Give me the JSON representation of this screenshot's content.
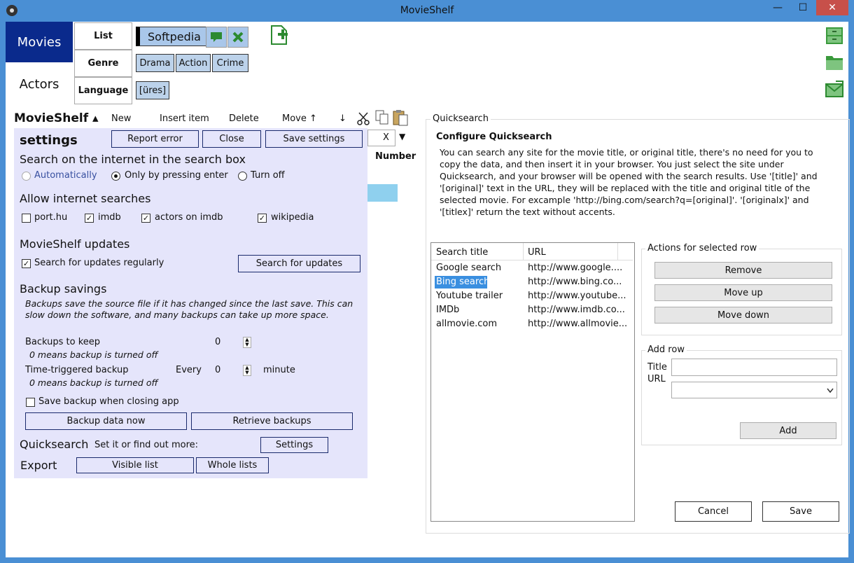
{
  "window": {
    "title": "MovieShelf",
    "minimize": "—",
    "maximize": "☐",
    "close": "✕"
  },
  "nav": {
    "movies": "Movies",
    "actors": "Actors"
  },
  "views": {
    "list": "List",
    "genre": "Genre",
    "language": "Language"
  },
  "filters": {
    "tag": "Softpedia",
    "genres": [
      "Drama",
      "Action",
      "Crime"
    ],
    "language_value": "[üres]"
  },
  "toolbar": {
    "brand": "MovieShelf ▴",
    "new": "New",
    "insert": "Insert item",
    "delete": "Delete",
    "move_up": "Move ↑",
    "move_down": "↓",
    "clear": "X",
    "dropdown": "▼",
    "column_number": "Number"
  },
  "settings": {
    "title": "settings",
    "report_error": "Report error",
    "close": "Close",
    "save_settings": "Save settings",
    "search_header": "Search on the internet in the search box",
    "search_options": [
      "Automatically",
      "Only by pressing enter",
      "Turn off"
    ],
    "allow_header": "Allow internet searches",
    "allow_options": [
      "port.hu",
      "imdb",
      "actors on imdb",
      "wikipedia"
    ],
    "updates_header": "MovieShelf updates",
    "search_regularly": "Search for updates regularly",
    "search_updates_btn": "Search for updates",
    "backup_header": "Backup savings",
    "backup_desc": "Backups save the source file if it has changed since the last save. This can slow down the software, and many backups can take up more space.",
    "backups_to_keep": "Backups to keep",
    "backups_to_keep_value": "0",
    "off_note": "0 means backup is turned off",
    "time_backup": "Time-triggered backup",
    "every": "Every",
    "time_value": "0",
    "minute": "minute",
    "off_note2": "0 means backup is turned off",
    "save_on_close": "Save backup when closing app",
    "backup_now": "Backup data now",
    "retrieve": "Retrieve backups",
    "quicksearch_label": "Quicksearch",
    "quicksearch_hint": "Set it or find out more:",
    "quicksearch_btn": "Settings",
    "export_label": "Export",
    "visible_list": "Visible list",
    "whole_lists": "Whole lists"
  },
  "quicksearch": {
    "group_label": "Quicksearch",
    "heading": "Configure Quicksearch",
    "description": "You can search any site for the movie title, or original title, there's no need for you to copy the data, and then insert it in your browser. You just select the site under Quicksearch, and your browser will be opened with the search results. Use '[title]' and '[original]' text in the URL, they will be replaced with the title and original title of the selected movie. For excample 'http://bing.com/search?q=[original]'. '[originalx]' and '[titlex]' return the text without accents.",
    "columns": [
      "Search title",
      "URL"
    ],
    "rows": [
      {
        "title": "Google search",
        "url": "http://www.google...."
      },
      {
        "title": "Bing search",
        "url": "http://www.bing.co..."
      },
      {
        "title": "Youtube trailer",
        "url": "http://www.youtube..."
      },
      {
        "title": "IMDb",
        "url": "http://www.imdb.co..."
      },
      {
        "title": "allmovie.com",
        "url": "http://www.allmovie..."
      }
    ],
    "actions_label": "Actions for selected row",
    "remove": "Remove",
    "move_up": "Move up",
    "move_down": "Move down",
    "add_row_label": "Add row",
    "title_label": "Title",
    "url_label": "URL",
    "add": "Add",
    "cancel": "Cancel",
    "save": "Save"
  },
  "colors": {
    "accent": "#0a2a8c",
    "titlebar": "#4a8fd4",
    "panel": "#e5e5fb",
    "chip": "#bcd2ea",
    "selection": "#3a8fe0"
  }
}
